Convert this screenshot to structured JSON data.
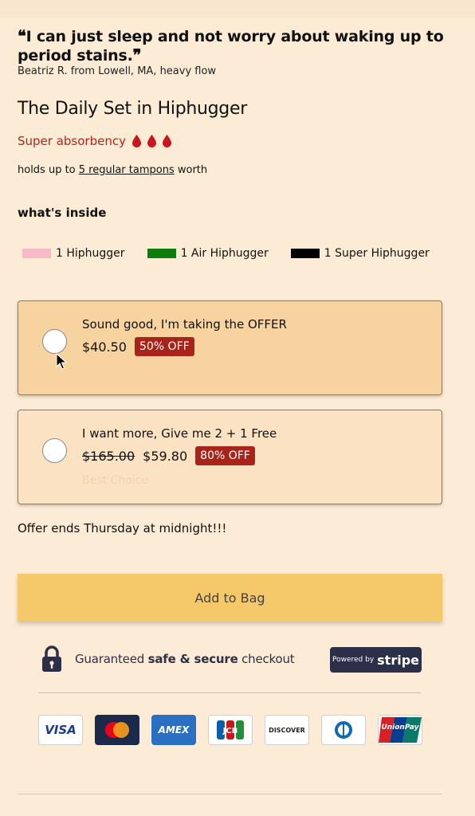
{
  "testimonial": {
    "quote": "I can just sleep and not worry about waking up to period stains.",
    "author": "Beatriz R. from Lowell, MA, heavy flow"
  },
  "product": {
    "title": "The Daily Set in Hiphugger",
    "absorbency_label": "Super absorbency",
    "holds_prefix": "holds up to ",
    "holds_link": "5 regular tampons",
    "holds_suffix": " worth"
  },
  "inside": {
    "title": "what's inside",
    "items": [
      {
        "label": "1 Hiphugger",
        "color": "#f9b8c8"
      },
      {
        "label": "1 Air Hiphugger",
        "color": "#0a7d0a"
      },
      {
        "label": "1 Super Hiphugger",
        "color": "#000000"
      }
    ]
  },
  "options": [
    {
      "label": "Sound good, I'm taking the OFFER",
      "old_price": "",
      "price": "$40.50",
      "badge": "50% OFF",
      "note": ""
    },
    {
      "label": "I want more, Give me 2 + 1 Free",
      "old_price": "$165.00",
      "price": "$59.80",
      "badge": "80% OFF",
      "note": "Best Choice"
    }
  ],
  "offer_ends": "Offer ends Thursday at midnight!!!",
  "add_to_bag": "Add to Bag",
  "secure": {
    "prefix": "Guaranteed ",
    "bold": "safe & secure",
    "suffix": " checkout",
    "powered_by": "Powered by",
    "stripe": "stripe"
  },
  "payment_cards": {
    "visa": "VISA",
    "amex": "AMEX",
    "jcb": "JCB",
    "discover": "DISCOVER",
    "unionpay": "UnionPay"
  },
  "colors": {
    "background": "#fcebd5",
    "accent_red": "#b3261e",
    "badge_red": "#a8231a",
    "selected_option": "#f6d39f",
    "option": "#fbe2c3",
    "button": "#f5c869",
    "stripe_navy": "#2b2f47"
  }
}
